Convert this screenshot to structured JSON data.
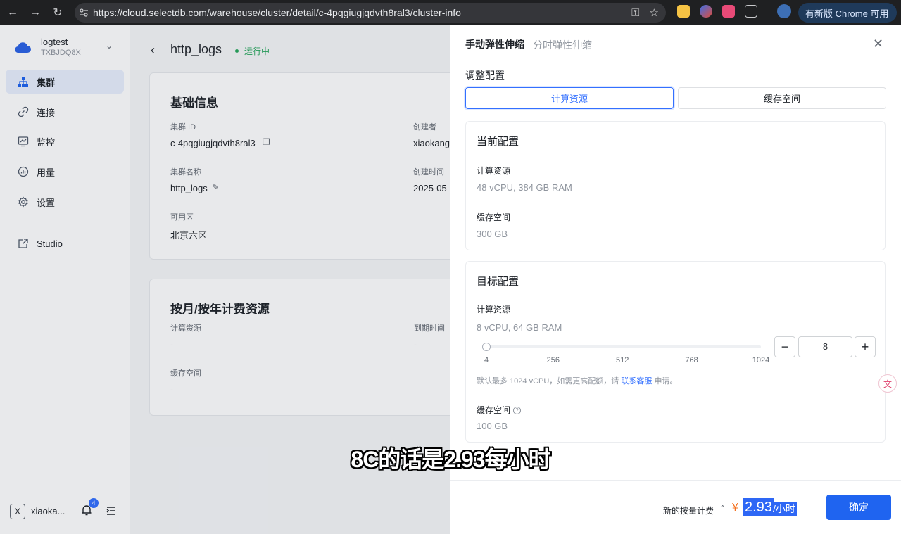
{
  "browser": {
    "url": "https://cloud.selectdb.com/warehouse/cluster/detail/c-4pqgiugjqdvth8ral3/cluster-info",
    "update_button": "有新版 Chrome 可用"
  },
  "sidebar": {
    "tenant_name": "logtest",
    "tenant_id": "TXBJDQ8X",
    "items": [
      {
        "label": "集群",
        "icon": "cluster-icon"
      },
      {
        "label": "连接",
        "icon": "link-icon"
      },
      {
        "label": "监控",
        "icon": "monitor-icon"
      },
      {
        "label": "用量",
        "icon": "usage-icon"
      },
      {
        "label": "设置",
        "icon": "settings-icon"
      },
      {
        "label": "Studio",
        "icon": "external-link-icon"
      }
    ],
    "user_initial": "X",
    "user_name": "xiaoka...",
    "notification_count": "4"
  },
  "main": {
    "title": "http_logs",
    "status": "运行中",
    "basic_info": {
      "title": "基础信息",
      "cluster_id_label": "集群 ID",
      "cluster_id": "c-4pqgiugjqdvth8ral3",
      "creator_label": "创建者",
      "creator": "xiaokang",
      "cluster_name_label": "集群名称",
      "cluster_name": "http_logs",
      "created_time_label": "创建时间",
      "created_time": "2025-05",
      "zone_label": "可用区",
      "zone": "北京六区"
    },
    "billing": {
      "title": "按月/按年计费资源",
      "compute_label": "计算资源",
      "compute": "-",
      "expire_label": "到期时间",
      "expire": "-",
      "cache_label": "缓存空间",
      "cache": "-"
    }
  },
  "drawer": {
    "tab_manual": "手动弹性伸缩",
    "tab_scheduled": "分时弹性伸缩",
    "adjust_title": "调整配置",
    "segment_compute": "计算资源",
    "segment_cache": "缓存空间",
    "current": {
      "title": "当前配置",
      "compute_label": "计算资源",
      "compute_value": "48 vCPU, 384 GB RAM",
      "cache_label": "缓存空间",
      "cache_value": "300 GB"
    },
    "target": {
      "title": "目标配置",
      "compute_label": "计算资源",
      "compute_value": "8 vCPU, 64 GB RAM",
      "slider_min": 4,
      "slider_max": 1024,
      "slider_value": 8,
      "ticks": [
        "4",
        "256",
        "512",
        "768",
        "1024"
      ],
      "stepper_value": "8",
      "hint_prefix": "默认最多 1024 vCPU，如需更高配额，请",
      "hint_link": "联系客服",
      "hint_suffix": "申请。",
      "cache_label": "缓存空间",
      "cache_value": "100 GB"
    },
    "footer": {
      "price_label": "新的按量计费",
      "currency": "¥",
      "price": "2.93",
      "unit": "/小时",
      "confirm": "确定"
    }
  },
  "subtitle": "8C的话是2.93每小时",
  "colors": {
    "accent": "#3370ff",
    "status_green": "#26a65b",
    "price_orange": "#f5701e"
  }
}
